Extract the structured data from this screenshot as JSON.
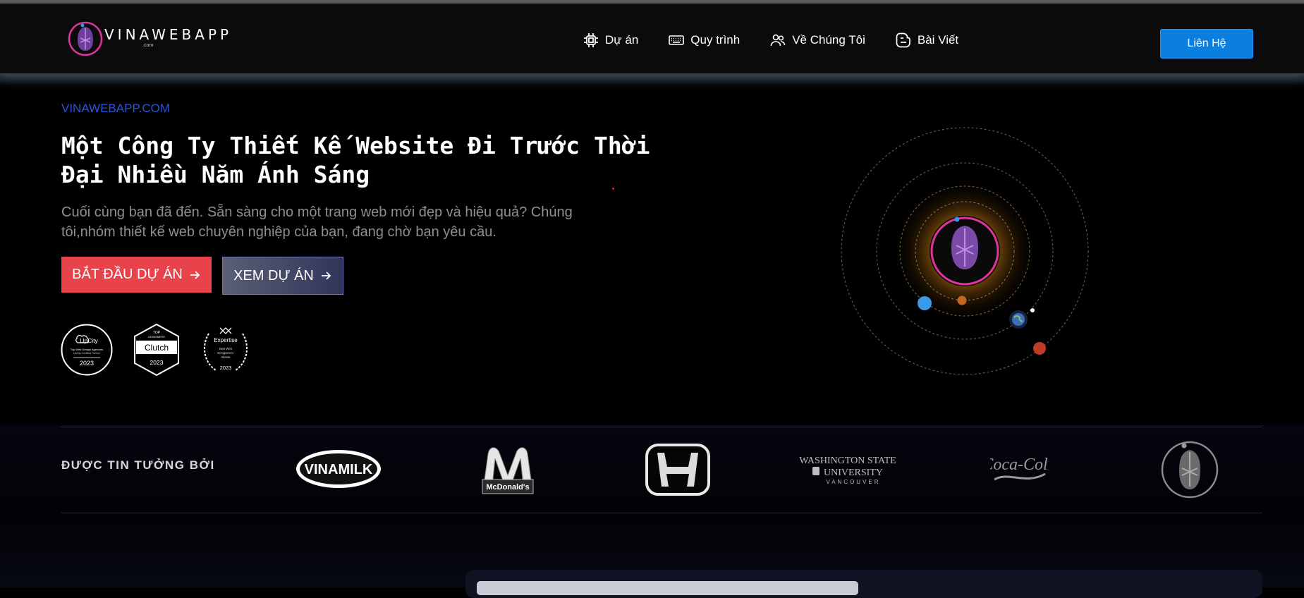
{
  "header": {
    "logo": {
      "word": "VINAWEBAPP",
      "suffix": ".com",
      "icon": "mouse-logo-icon"
    },
    "nav": [
      {
        "label": "Dự án",
        "icon": "chip-icon"
      },
      {
        "label": "Quy trình",
        "icon": "keyboard-icon"
      },
      {
        "label": "Về Chúng Tôi",
        "icon": "users-icon"
      },
      {
        "label": "Bài Viết",
        "icon": "blog-icon"
      }
    ],
    "contact_label": "Liên Hệ",
    "contact_color": "#0b7fe0"
  },
  "hero": {
    "eyebrow": "VINAWEBAPP.COM",
    "title_line1": "Một Công Ty Thiết Kế Website Đi Trước Thời",
    "title_line2": "Đại Nhiều Năm Ánh Sáng",
    "description": "Cuối cùng bạn đã đến. Sẵn sàng cho một trang web mới đẹp và hiệu quả? Chúng tôi,nhóm thiết kế web chuyên nghiệp của bạn, đang chờ bạn yêu cầu.",
    "primary_button": "BẮT ĐẦU DỰ ÁN",
    "secondary_button": "XEM DỰ ÁN",
    "primary_color": "#e8424b",
    "badges": {
      "upcity": {
        "brand": "UpCity",
        "line1": "Top Web Design Agencies",
        "line2": "UpCity Certified Partner",
        "year": "2023"
      },
      "clutch": {
        "top": "TOP",
        "sub": "DESIGNERS",
        "brand": "Clutch",
        "year": "2023"
      },
      "expertise": {
        "brand": "Expertise",
        "line1": "Best Web",
        "line2": "Designers in",
        "line3": "Atlanta",
        "year": "2023"
      }
    },
    "illustration": "solar-system-orbit-with-mouse-logo"
  },
  "trusted": {
    "label": "ĐƯỢC TIN TƯỞNG BỞI",
    "brands": {
      "vinamilk": "VINAMILK",
      "mcdonalds": "McDonald's",
      "honda": "honda-logo",
      "wsu_line1": "WASHINGTON STATE",
      "wsu_line2": "UNIVERSITY",
      "wsu_line3": "VANCOUVER",
      "cocacola": "Coca-Cola",
      "vinawebapp": "mouse-logo"
    }
  }
}
